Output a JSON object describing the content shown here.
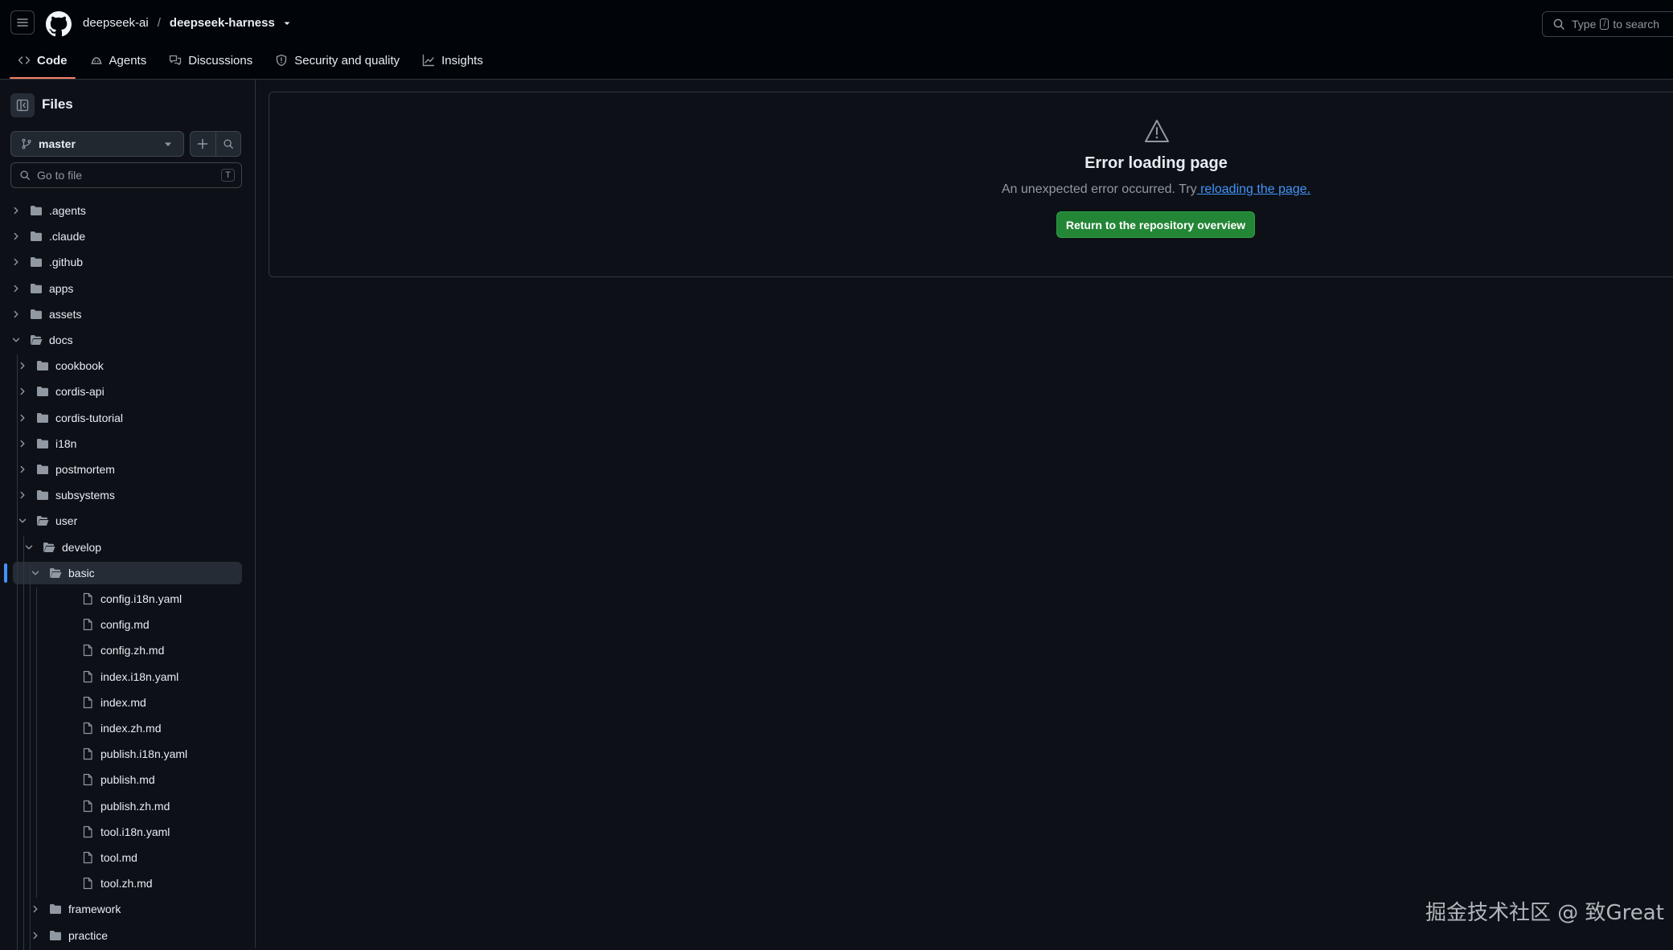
{
  "header": {
    "owner": "deepseek-ai",
    "separator": "/",
    "repo": "deepseek-harness",
    "search": {
      "prefix": "Type",
      "key": "/",
      "suffix": "to search"
    }
  },
  "tabs": [
    {
      "label": "Code",
      "icon": "code-icon",
      "active": true
    },
    {
      "label": "Agents",
      "icon": "agent-icon"
    },
    {
      "label": "Discussions",
      "icon": "comment-discussion-icon"
    },
    {
      "label": "Security and quality",
      "icon": "shield-icon"
    },
    {
      "label": "Insights",
      "icon": "graph-icon"
    }
  ],
  "sidebar": {
    "title": "Files",
    "branch": "master",
    "goto_placeholder": "Go to file",
    "goto_key": "T",
    "tree": [
      {
        "name": ".agents",
        "type": "folder",
        "depth": 0,
        "open": false
      },
      {
        "name": ".claude",
        "type": "folder",
        "depth": 0,
        "open": false
      },
      {
        "name": ".github",
        "type": "folder",
        "depth": 0,
        "open": false
      },
      {
        "name": "apps",
        "type": "folder",
        "depth": 0,
        "open": false
      },
      {
        "name": "assets",
        "type": "folder",
        "depth": 0,
        "open": false
      },
      {
        "name": "docs",
        "type": "folder",
        "depth": 0,
        "open": true
      },
      {
        "name": "cookbook",
        "type": "folder",
        "depth": 1,
        "open": false
      },
      {
        "name": "cordis-api",
        "type": "folder",
        "depth": 1,
        "open": false
      },
      {
        "name": "cordis-tutorial",
        "type": "folder",
        "depth": 1,
        "open": false
      },
      {
        "name": "i18n",
        "type": "folder",
        "depth": 1,
        "open": false
      },
      {
        "name": "postmortem",
        "type": "folder",
        "depth": 1,
        "open": false
      },
      {
        "name": "subsystems",
        "type": "folder",
        "depth": 1,
        "open": false
      },
      {
        "name": "user",
        "type": "folder",
        "depth": 1,
        "open": true
      },
      {
        "name": "develop",
        "type": "folder",
        "depth": 2,
        "open": true
      },
      {
        "name": "basic",
        "type": "folder",
        "depth": 3,
        "open": true,
        "selected": true
      },
      {
        "name": "config.i18n.yaml",
        "type": "file",
        "depth": 4
      },
      {
        "name": "config.md",
        "type": "file",
        "depth": 4
      },
      {
        "name": "config.zh.md",
        "type": "file",
        "depth": 4
      },
      {
        "name": "index.i18n.yaml",
        "type": "file",
        "depth": 4
      },
      {
        "name": "index.md",
        "type": "file",
        "depth": 4
      },
      {
        "name": "index.zh.md",
        "type": "file",
        "depth": 4
      },
      {
        "name": "publish.i18n.yaml",
        "type": "file",
        "depth": 4
      },
      {
        "name": "publish.md",
        "type": "file",
        "depth": 4
      },
      {
        "name": "publish.zh.md",
        "type": "file",
        "depth": 4
      },
      {
        "name": "tool.i18n.yaml",
        "type": "file",
        "depth": 4
      },
      {
        "name": "tool.md",
        "type": "file",
        "depth": 4
      },
      {
        "name": "tool.zh.md",
        "type": "file",
        "depth": 4
      },
      {
        "name": "framework",
        "type": "folder",
        "depth": 3,
        "open": false
      },
      {
        "name": "practice",
        "type": "folder",
        "depth": 3,
        "open": false
      }
    ]
  },
  "main": {
    "error_title": "Error loading page",
    "error_message": "An unexpected error occurred. Try",
    "error_link": " reloading the page.",
    "return_button": "Return to the repository overview"
  },
  "watermark": "掘金技术社区 @ 致Great",
  "colors": {
    "background": "#0d1117",
    "header_bg": "#010409",
    "border": "#30363d",
    "accent_tab": "#f78166",
    "link": "#4493f8",
    "primary_button": "#238636"
  }
}
